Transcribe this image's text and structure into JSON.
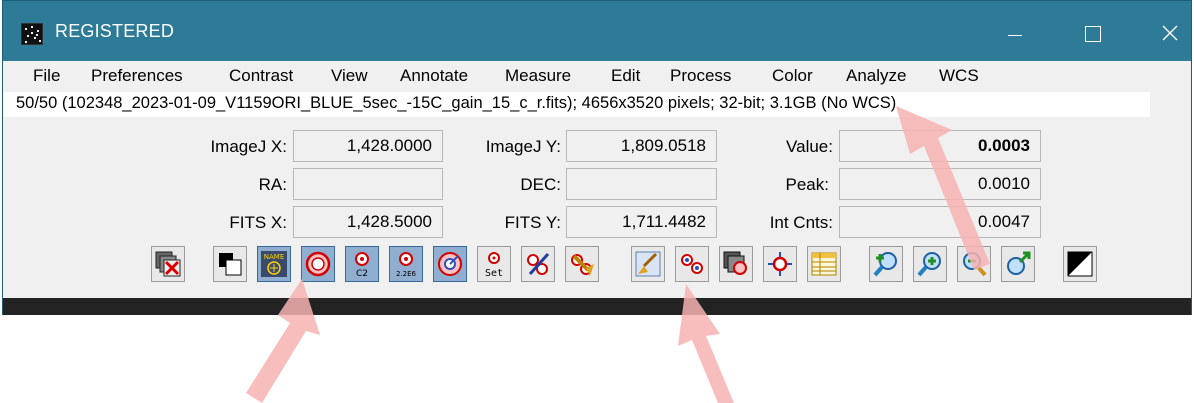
{
  "window": {
    "title": "REGISTERED"
  },
  "menu": [
    "File",
    "Preferences",
    "Contrast",
    "View",
    "Annotate",
    "Measure",
    "Edit",
    "Process",
    "Color",
    "Analyze",
    "WCS"
  ],
  "info_line": "50/50 (102348_2023-01-09_V1159ORI_BLUE_5sec_-15C_gain_15_c_r.fits); 4656x3520 pixels; 32-bit; 3.1GB (No WCS)",
  "coords": {
    "imagej_x": {
      "label": "ImageJ X:",
      "value": "1,428.0000"
    },
    "imagej_y": {
      "label": "ImageJ Y:",
      "value": "1,809.0518"
    },
    "value": {
      "label": "Value:",
      "value": "0.0003"
    },
    "ra": {
      "label": "RA:",
      "value": ""
    },
    "dec": {
      "label": "DEC:",
      "value": ""
    },
    "peak": {
      "label": "Peak:",
      "value": "0.0010"
    },
    "fits_x": {
      "label": "FITS X:",
      "value": "1,428.5000"
    },
    "fits_y": {
      "label": "FITS Y:",
      "value": "1,711.4482"
    },
    "int_cnts": {
      "label": "Int Cnts:",
      "value": "0.0047"
    }
  },
  "toolbar": {
    "name_label": "NAME",
    "c2_label": "C2",
    "scale_label": "2.2E6",
    "set_label": "Set"
  },
  "colors": {
    "titlebar": "#2e7b97",
    "selected_button": "#8faed0",
    "annotation_arrow": "#f7b3b3"
  },
  "icons": [
    "close-all-icon",
    "invert-icon",
    "show-name-icon",
    "aperture-icon",
    "centroid-icon",
    "scale-icon",
    "mag-icon",
    "set-aperture-icon",
    "edit-aperture-icon",
    "clear-aperture-icon",
    "broom-icon",
    "multi-aperture-icon",
    "stack-icon",
    "crosshair-icon",
    "table-icon",
    "zoom-in-icon",
    "zoom-icon",
    "zoom-out-icon",
    "zoom-fit-icon",
    "negative-icon"
  ]
}
